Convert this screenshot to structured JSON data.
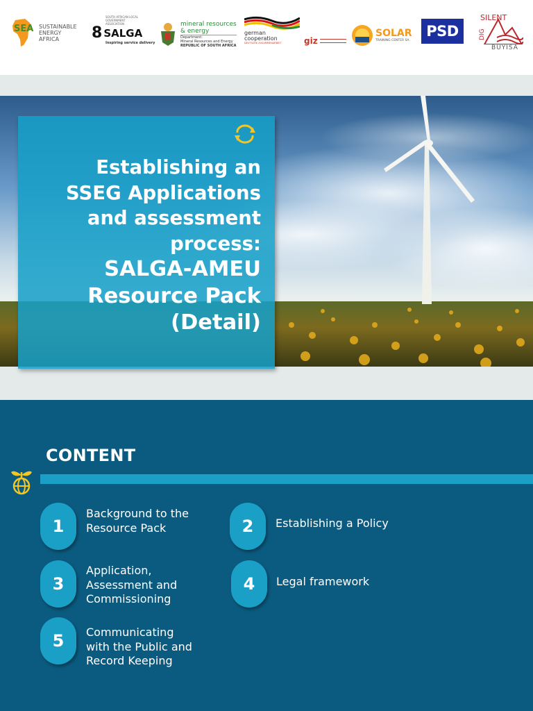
{
  "logos": {
    "sea": {
      "mark": "SEA",
      "line1": "SUSTAINABLE",
      "line2": "ENERGY",
      "line3": "AFRICA"
    },
    "salga": {
      "mark": "8",
      "name": "SALGA",
      "tagline": "Inspiring service delivery",
      "small": "SOUTH AFRICAN LOCAL GOVERNMENT ASSOCIATION"
    },
    "dmre": {
      "line1": "mineral resources",
      "line2": "& energy",
      "dept": "Department:",
      "dept_name": "Mineral Resources and Energy",
      "country": "REPUBLIC OF SOUTH AFRICA"
    },
    "german": {
      "line1": "german",
      "line2": "cooperation",
      "line3": "DEUTSCHE ZUSAMMENARBEIT"
    },
    "giz": {
      "name": "giz"
    },
    "solar": {
      "name": "SOLAR",
      "sub": "TRAINING CENTER SA"
    },
    "psd": {
      "name": "PSD"
    },
    "silent": {
      "line1": "SILENT",
      "line2": "DIG",
      "line3": "BUYISA"
    }
  },
  "hero": {
    "title_lines": [
      "Establishing an",
      "SSEG Applications",
      "and assessment",
      "process:"
    ],
    "subtitle_lines": [
      "SALGA-AMEU",
      "Resource Pack",
      "(Detail)"
    ],
    "icon": "recycle-arrows-icon"
  },
  "content": {
    "heading": "CONTENT",
    "icon": "plant-globe-icon",
    "items": [
      {
        "number": "1",
        "lines": [
          "Background to the",
          "Resource Pack"
        ]
      },
      {
        "number": "2",
        "lines": [
          "Establishing a Policy"
        ]
      },
      {
        "number": "3",
        "lines": [
          "Application,",
          "Assessment and",
          "Commissioning"
        ]
      },
      {
        "number": "4",
        "lines": [
          "Legal framework"
        ]
      },
      {
        "number": "5",
        "lines": [
          "Communicating",
          "with the Public and",
          "Record Keeping"
        ]
      }
    ]
  },
  "colors": {
    "dark_teal": "#0b5b80",
    "accent_blue": "#1aa0c6",
    "strip_grey": "#e4e9ea",
    "icon_yellow": "#f3c623"
  }
}
